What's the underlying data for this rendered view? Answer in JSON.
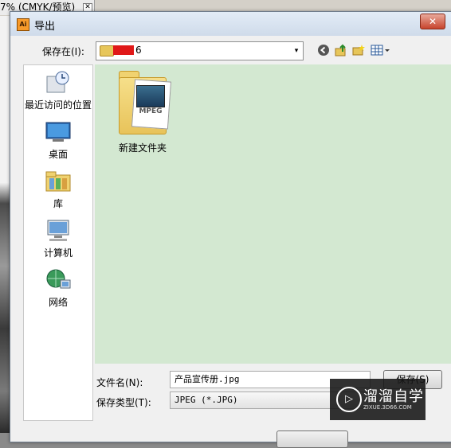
{
  "background_app": {
    "tab_label": "7% (CMYK/预览)",
    "tab_close": "✕"
  },
  "dialog": {
    "title": "导出",
    "app_icon_text": "Ai",
    "close": "✕",
    "save_in": {
      "label": "保存在(I):",
      "current_folder": "6",
      "dropdown_arrow": "▾"
    },
    "nav_icons": [
      "back-icon",
      "up-folder-icon",
      "new-folder-icon",
      "view-menu-icon"
    ],
    "places": [
      {
        "label": "最近访问的位置",
        "icon": "recent-places-icon"
      },
      {
        "label": "桌面",
        "icon": "desktop-icon"
      },
      {
        "label": "库",
        "icon": "libraries-icon"
      },
      {
        "label": "计算机",
        "icon": "computer-icon"
      },
      {
        "label": "网络",
        "icon": "network-icon"
      }
    ],
    "files": [
      {
        "name": "新建文件夹",
        "badge": "MPEG"
      }
    ],
    "filename": {
      "label": "文件名(N):",
      "value": "产品宣传册.jpg"
    },
    "filetype": {
      "label": "保存类型(T):",
      "value": "JPEG (*.JPG)"
    },
    "save_button": "保存(S)"
  },
  "watermark": {
    "brand": "溜溜自学",
    "url": "ZIXUE.3D66.COM",
    "logo": "▷"
  },
  "colors": {
    "file_area_bg": "#d3e8d1",
    "titlebar": "#dce6f2",
    "close_button": "#c7442c"
  }
}
